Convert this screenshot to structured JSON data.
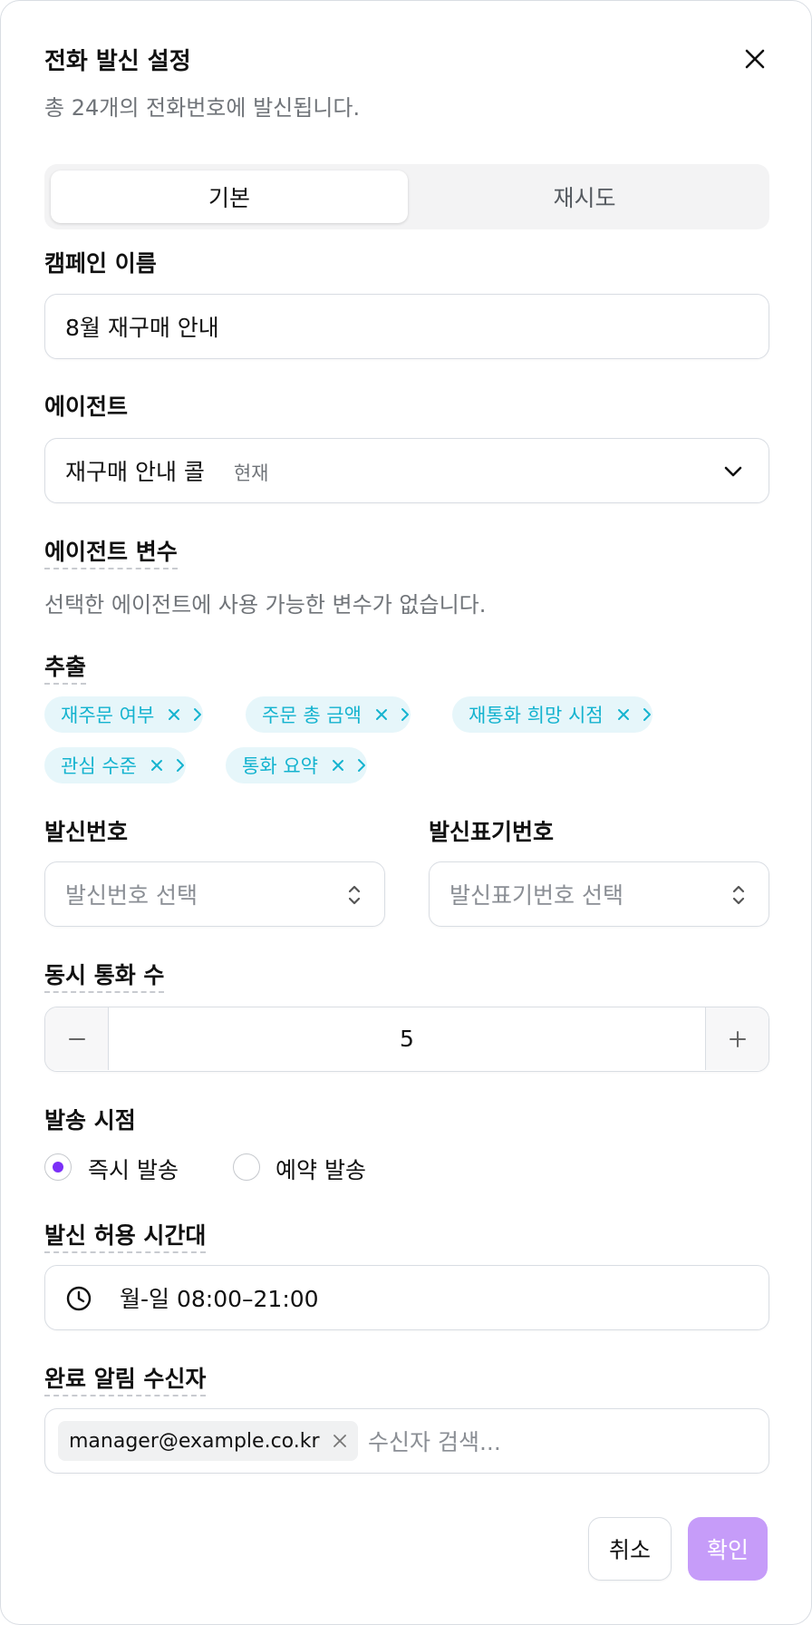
{
  "dialog": {
    "title": "전화 발신 설정",
    "subtitle": "총 24개의 전화번호에 발신됩니다."
  },
  "tabs": [
    {
      "label": "기본",
      "active": true
    },
    {
      "label": "재시도",
      "active": false
    }
  ],
  "campaign": {
    "label": "캠페인 이름",
    "value": "8월 재구매 안내"
  },
  "agent": {
    "label": "에이전트",
    "value": "재구매 안내 콜",
    "badge": "현재"
  },
  "agent_vars": {
    "label": "에이전트 변수",
    "hint": "선택한 에이전트에 사용 가능한 변수가 없습니다."
  },
  "extraction": {
    "label": "추출",
    "chips": [
      "재주문 여부",
      "주문 총 금액",
      "재통화 희망 시점",
      "관심 수준",
      "통화 요약"
    ]
  },
  "caller": {
    "number_label": "발신번호",
    "number_placeholder": "발신번호 선택",
    "display_label": "발신표기번호",
    "display_placeholder": "발신표기번호 선택"
  },
  "concurrency": {
    "label": "동시 통화 수",
    "value": "5"
  },
  "send_time": {
    "label": "발송 시점",
    "options": [
      {
        "label": "즉시 발송",
        "checked": true
      },
      {
        "label": "예약 발송",
        "checked": false
      }
    ]
  },
  "allowed_hours": {
    "label": "발신 허용 시간대",
    "value": "월-일 08:00–21:00"
  },
  "recipients": {
    "label": "완료 알림 수신자",
    "tag": "manager@example.co.kr",
    "placeholder": "수신자 검색..."
  },
  "footer": {
    "cancel_label": "취소",
    "confirm_label": "확인"
  },
  "colors": {
    "accent": "#7b2ff7",
    "confirm_disabled": "#c69cf9",
    "chip_bg": "#e6f6fa",
    "chip_text": "#14b3cf"
  },
  "icons": [
    "close-icon",
    "chevron-down-icon",
    "chip-remove-icon",
    "chevron-right-icon",
    "updown-icon",
    "minus-icon",
    "plus-icon",
    "clock-icon",
    "tag-remove-icon"
  ]
}
